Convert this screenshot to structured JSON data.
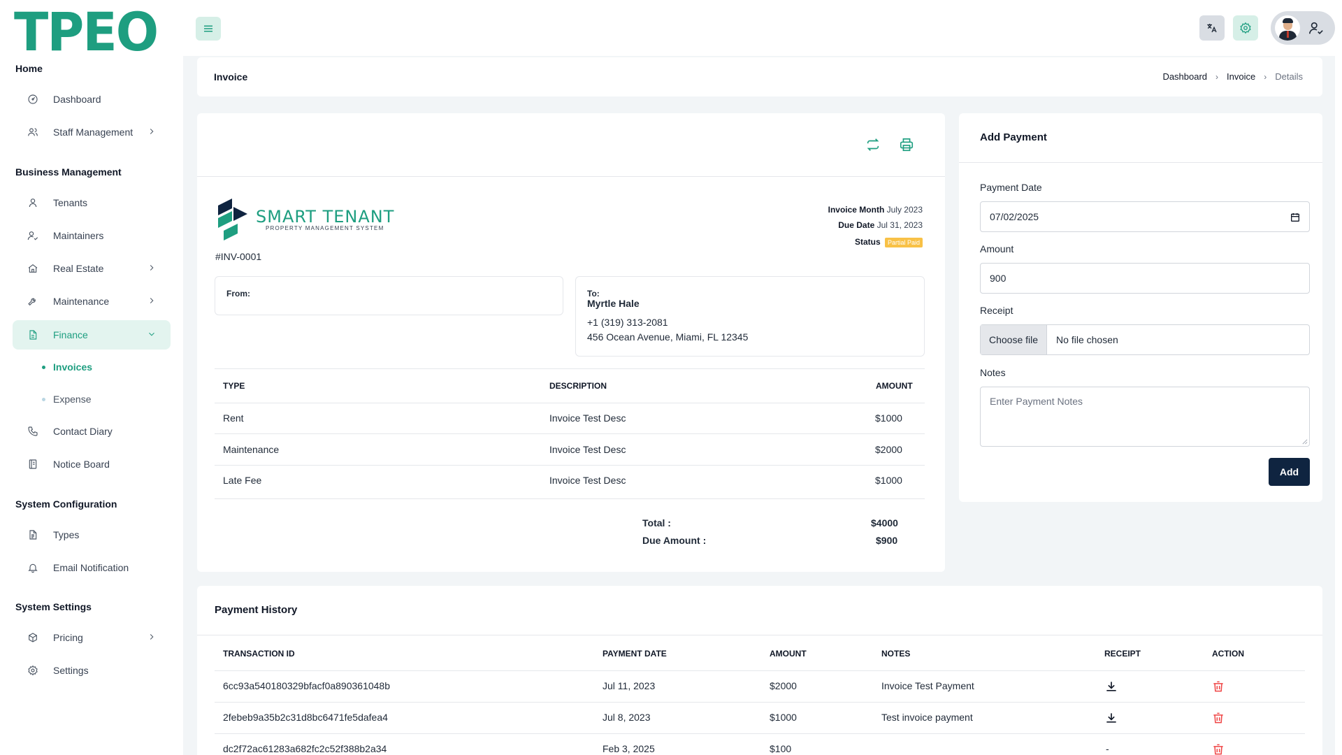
{
  "app": {
    "logo_text": "TPEO",
    "accent_color": "#1e9e80"
  },
  "sidebar": {
    "sections": [
      {
        "label": "Home"
      },
      {
        "label": "Business Management"
      },
      {
        "label": "System Configuration"
      },
      {
        "label": "System Settings"
      }
    ],
    "items": [
      {
        "label": "Dashboard",
        "icon": "dashboard-icon"
      },
      {
        "label": "Staff Management",
        "icon": "users-icon",
        "has_submenu": true
      },
      {
        "label": "Tenants",
        "icon": "user-icon"
      },
      {
        "label": "Maintainers",
        "icon": "user-check-icon"
      },
      {
        "label": "Real Estate",
        "icon": "home-icon",
        "has_submenu": true
      },
      {
        "label": "Maintenance",
        "icon": "tool-icon",
        "has_submenu": true
      },
      {
        "label": "Finance",
        "icon": "file-icon",
        "has_submenu": true,
        "active": true
      },
      {
        "label": "Contact Diary",
        "icon": "phone-icon"
      },
      {
        "label": "Notice Board",
        "icon": "notebook-icon"
      },
      {
        "label": "Types",
        "icon": "file-text-icon"
      },
      {
        "label": "Email Notification",
        "icon": "bell-icon"
      },
      {
        "label": "Pricing",
        "icon": "package-icon",
        "has_submenu": true
      },
      {
        "label": "Settings",
        "icon": "gear-icon"
      }
    ],
    "finance_subitems": [
      {
        "label": "Invoices",
        "active": true
      },
      {
        "label": "Expense"
      }
    ]
  },
  "page": {
    "title": "Invoice",
    "breadcrumb": [
      "Dashboard",
      "Invoice",
      "Details"
    ]
  },
  "invoice": {
    "company_name": "SMART TENANT",
    "company_tagline": "PROPERTY MANAGEMENT SYSTEM",
    "number": "#INV-0001",
    "invoice_month_label": "Invoice Month",
    "invoice_month": "July 2023",
    "due_date_label": "Due Date",
    "due_date": "Jul 31, 2023",
    "status_label": "Status",
    "status": "Partial Paid",
    "status_color": "#f8c146",
    "from_label": "From:",
    "to_label": "To:",
    "to_name": "Myrtle Hale",
    "to_phone": "+1 (319) 313-2081",
    "to_address": "456 Ocean Avenue, Miami, FL 12345",
    "columns": [
      "TYPE",
      "DESCRIPTION",
      "AMOUNT"
    ],
    "rows": [
      {
        "type": "Rent",
        "description": "Invoice Test Desc",
        "amount": "$1000"
      },
      {
        "type": "Maintenance",
        "description": "Invoice Test Desc",
        "amount": "$2000"
      },
      {
        "type": "Late Fee",
        "description": "Invoice Test Desc",
        "amount": "$1000"
      }
    ],
    "total_label": "Total :",
    "total": "$4000",
    "due_label": "Due Amount :",
    "due": "$900"
  },
  "payment_form": {
    "title": "Add Payment",
    "date_label": "Payment Date",
    "date_value": "07/02/2025",
    "amount_label": "Amount",
    "amount_value": "900",
    "receipt_label": "Receipt",
    "choose_file": "Choose file",
    "no_file": "No file chosen",
    "notes_label": "Notes",
    "notes_placeholder": "Enter Payment Notes",
    "submit": "Add"
  },
  "history": {
    "title": "Payment History",
    "columns": [
      "TRANSACTION ID",
      "PAYMENT DATE",
      "AMOUNT",
      "NOTES",
      "RECEIPT",
      "ACTION"
    ],
    "rows": [
      {
        "id": "6cc93a540180329bfacf0a890361048b",
        "date": "Jul 11, 2023",
        "amount": "$2000",
        "notes": "Invoice Test Payment",
        "receipt": "download-icon"
      },
      {
        "id": "2febeb9a35b2c31d8bc6471fe5dafea4",
        "date": "Jul 8, 2023",
        "amount": "$1000",
        "notes": "Test invoice payment",
        "receipt": "download-icon"
      },
      {
        "id": "dc2f72ac61283a682fc2c52f388b2a34",
        "date": "Feb 3, 2025",
        "amount": "$100",
        "notes": "",
        "receipt": "-"
      }
    ]
  }
}
